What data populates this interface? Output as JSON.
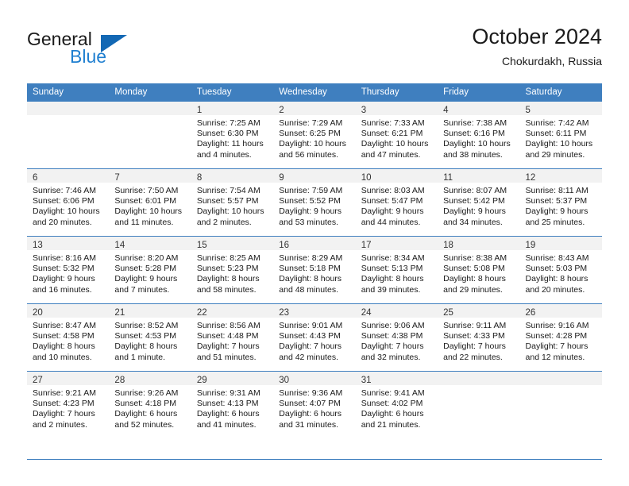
{
  "brand": {
    "name_part1": "General",
    "name_part2": "Blue",
    "accent_color": "#1368b4",
    "blue_text_color": "#1f7fd0"
  },
  "header": {
    "title": "October 2024",
    "location": "Chokurdakh, Russia"
  },
  "theme": {
    "header_row_bg": "#3f7fbf",
    "daynum_bg": "#f2f2f2",
    "grid_line": "#3f7fbf"
  },
  "weekdays": [
    "Sunday",
    "Monday",
    "Tuesday",
    "Wednesday",
    "Thursday",
    "Friday",
    "Saturday"
  ],
  "weeks": [
    [
      {
        "day": "",
        "sunrise": "",
        "sunset": "",
        "daylight_line1": "",
        "daylight_line2": ""
      },
      {
        "day": "",
        "sunrise": "",
        "sunset": "",
        "daylight_line1": "",
        "daylight_line2": ""
      },
      {
        "day": "1",
        "sunrise": "Sunrise: 7:25 AM",
        "sunset": "Sunset: 6:30 PM",
        "daylight_line1": "Daylight: 11 hours",
        "daylight_line2": "and 4 minutes."
      },
      {
        "day": "2",
        "sunrise": "Sunrise: 7:29 AM",
        "sunset": "Sunset: 6:25 PM",
        "daylight_line1": "Daylight: 10 hours",
        "daylight_line2": "and 56 minutes."
      },
      {
        "day": "3",
        "sunrise": "Sunrise: 7:33 AM",
        "sunset": "Sunset: 6:21 PM",
        "daylight_line1": "Daylight: 10 hours",
        "daylight_line2": "and 47 minutes."
      },
      {
        "day": "4",
        "sunrise": "Sunrise: 7:38 AM",
        "sunset": "Sunset: 6:16 PM",
        "daylight_line1": "Daylight: 10 hours",
        "daylight_line2": "and 38 minutes."
      },
      {
        "day": "5",
        "sunrise": "Sunrise: 7:42 AM",
        "sunset": "Sunset: 6:11 PM",
        "daylight_line1": "Daylight: 10 hours",
        "daylight_line2": "and 29 minutes."
      }
    ],
    [
      {
        "day": "6",
        "sunrise": "Sunrise: 7:46 AM",
        "sunset": "Sunset: 6:06 PM",
        "daylight_line1": "Daylight: 10 hours",
        "daylight_line2": "and 20 minutes."
      },
      {
        "day": "7",
        "sunrise": "Sunrise: 7:50 AM",
        "sunset": "Sunset: 6:01 PM",
        "daylight_line1": "Daylight: 10 hours",
        "daylight_line2": "and 11 minutes."
      },
      {
        "day": "8",
        "sunrise": "Sunrise: 7:54 AM",
        "sunset": "Sunset: 5:57 PM",
        "daylight_line1": "Daylight: 10 hours",
        "daylight_line2": "and 2 minutes."
      },
      {
        "day": "9",
        "sunrise": "Sunrise: 7:59 AM",
        "sunset": "Sunset: 5:52 PM",
        "daylight_line1": "Daylight: 9 hours",
        "daylight_line2": "and 53 minutes."
      },
      {
        "day": "10",
        "sunrise": "Sunrise: 8:03 AM",
        "sunset": "Sunset: 5:47 PM",
        "daylight_line1": "Daylight: 9 hours",
        "daylight_line2": "and 44 minutes."
      },
      {
        "day": "11",
        "sunrise": "Sunrise: 8:07 AM",
        "sunset": "Sunset: 5:42 PM",
        "daylight_line1": "Daylight: 9 hours",
        "daylight_line2": "and 34 minutes."
      },
      {
        "day": "12",
        "sunrise": "Sunrise: 8:11 AM",
        "sunset": "Sunset: 5:37 PM",
        "daylight_line1": "Daylight: 9 hours",
        "daylight_line2": "and 25 minutes."
      }
    ],
    [
      {
        "day": "13",
        "sunrise": "Sunrise: 8:16 AM",
        "sunset": "Sunset: 5:32 PM",
        "daylight_line1": "Daylight: 9 hours",
        "daylight_line2": "and 16 minutes."
      },
      {
        "day": "14",
        "sunrise": "Sunrise: 8:20 AM",
        "sunset": "Sunset: 5:28 PM",
        "daylight_line1": "Daylight: 9 hours",
        "daylight_line2": "and 7 minutes."
      },
      {
        "day": "15",
        "sunrise": "Sunrise: 8:25 AM",
        "sunset": "Sunset: 5:23 PM",
        "daylight_line1": "Daylight: 8 hours",
        "daylight_line2": "and 58 minutes."
      },
      {
        "day": "16",
        "sunrise": "Sunrise: 8:29 AM",
        "sunset": "Sunset: 5:18 PM",
        "daylight_line1": "Daylight: 8 hours",
        "daylight_line2": "and 48 minutes."
      },
      {
        "day": "17",
        "sunrise": "Sunrise: 8:34 AM",
        "sunset": "Sunset: 5:13 PM",
        "daylight_line1": "Daylight: 8 hours",
        "daylight_line2": "and 39 minutes."
      },
      {
        "day": "18",
        "sunrise": "Sunrise: 8:38 AM",
        "sunset": "Sunset: 5:08 PM",
        "daylight_line1": "Daylight: 8 hours",
        "daylight_line2": "and 29 minutes."
      },
      {
        "day": "19",
        "sunrise": "Sunrise: 8:43 AM",
        "sunset": "Sunset: 5:03 PM",
        "daylight_line1": "Daylight: 8 hours",
        "daylight_line2": "and 20 minutes."
      }
    ],
    [
      {
        "day": "20",
        "sunrise": "Sunrise: 8:47 AM",
        "sunset": "Sunset: 4:58 PM",
        "daylight_line1": "Daylight: 8 hours",
        "daylight_line2": "and 10 minutes."
      },
      {
        "day": "21",
        "sunrise": "Sunrise: 8:52 AM",
        "sunset": "Sunset: 4:53 PM",
        "daylight_line1": "Daylight: 8 hours",
        "daylight_line2": "and 1 minute."
      },
      {
        "day": "22",
        "sunrise": "Sunrise: 8:56 AM",
        "sunset": "Sunset: 4:48 PM",
        "daylight_line1": "Daylight: 7 hours",
        "daylight_line2": "and 51 minutes."
      },
      {
        "day": "23",
        "sunrise": "Sunrise: 9:01 AM",
        "sunset": "Sunset: 4:43 PM",
        "daylight_line1": "Daylight: 7 hours",
        "daylight_line2": "and 42 minutes."
      },
      {
        "day": "24",
        "sunrise": "Sunrise: 9:06 AM",
        "sunset": "Sunset: 4:38 PM",
        "daylight_line1": "Daylight: 7 hours",
        "daylight_line2": "and 32 minutes."
      },
      {
        "day": "25",
        "sunrise": "Sunrise: 9:11 AM",
        "sunset": "Sunset: 4:33 PM",
        "daylight_line1": "Daylight: 7 hours",
        "daylight_line2": "and 22 minutes."
      },
      {
        "day": "26",
        "sunrise": "Sunrise: 9:16 AM",
        "sunset": "Sunset: 4:28 PM",
        "daylight_line1": "Daylight: 7 hours",
        "daylight_line2": "and 12 minutes."
      }
    ],
    [
      {
        "day": "27",
        "sunrise": "Sunrise: 9:21 AM",
        "sunset": "Sunset: 4:23 PM",
        "daylight_line1": "Daylight: 7 hours",
        "daylight_line2": "and 2 minutes."
      },
      {
        "day": "28",
        "sunrise": "Sunrise: 9:26 AM",
        "sunset": "Sunset: 4:18 PM",
        "daylight_line1": "Daylight: 6 hours",
        "daylight_line2": "and 52 minutes."
      },
      {
        "day": "29",
        "sunrise": "Sunrise: 9:31 AM",
        "sunset": "Sunset: 4:13 PM",
        "daylight_line1": "Daylight: 6 hours",
        "daylight_line2": "and 41 minutes."
      },
      {
        "day": "30",
        "sunrise": "Sunrise: 9:36 AM",
        "sunset": "Sunset: 4:07 PM",
        "daylight_line1": "Daylight: 6 hours",
        "daylight_line2": "and 31 minutes."
      },
      {
        "day": "31",
        "sunrise": "Sunrise: 9:41 AM",
        "sunset": "Sunset: 4:02 PM",
        "daylight_line1": "Daylight: 6 hours",
        "daylight_line2": "and 21 minutes."
      },
      {
        "day": "",
        "sunrise": "",
        "sunset": "",
        "daylight_line1": "",
        "daylight_line2": ""
      },
      {
        "day": "",
        "sunrise": "",
        "sunset": "",
        "daylight_line1": "",
        "daylight_line2": ""
      }
    ]
  ]
}
